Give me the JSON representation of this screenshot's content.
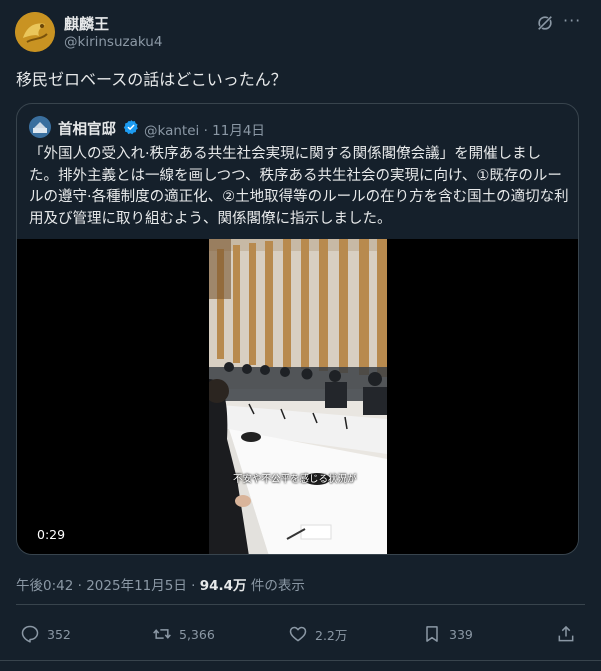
{
  "tweet": {
    "author_name": "麒麟王",
    "author_handle": "@kirinsuzaku4",
    "text": "移民ゼロベースの話はどこいったん？",
    "more_label": "···"
  },
  "quoted": {
    "author_name": "首相官邸",
    "author_handle": "@kantei",
    "date": "11月4日",
    "separator": "·",
    "text": "「外国人の受入れ·秩序ある共生社会実現に関する関係閣僚会議」を開催しました。排外主義とは一線を画しつつ、秩序ある共生社会の実現に向け、①既存のルールの遵守·各種制度の適正化、②土地取得等のルールの在り方を含む国土の適切な利用及び管理に取り組むよう、関係閣僚に指示しました。",
    "video": {
      "caption": "不安や不公平を感じる状況が",
      "duration": "0:29"
    }
  },
  "meta": {
    "time": "午後0:42",
    "separator": "·",
    "date": "2025年11月5日",
    "views": "94.4万",
    "views_label": "件の表示"
  },
  "actions": {
    "replies": "352",
    "retweets": "5,366",
    "likes": "2.2万",
    "bookmarks": "339"
  },
  "colors": {
    "background": "#15202b",
    "border": "#38444d",
    "secondary_text": "#8b98a5",
    "verified": "#1d9bf0"
  },
  "icons": [
    "grok-icon",
    "more-icon",
    "verified-badge-icon",
    "reply-icon",
    "retweet-icon",
    "like-icon",
    "bookmark-icon",
    "share-icon"
  ]
}
